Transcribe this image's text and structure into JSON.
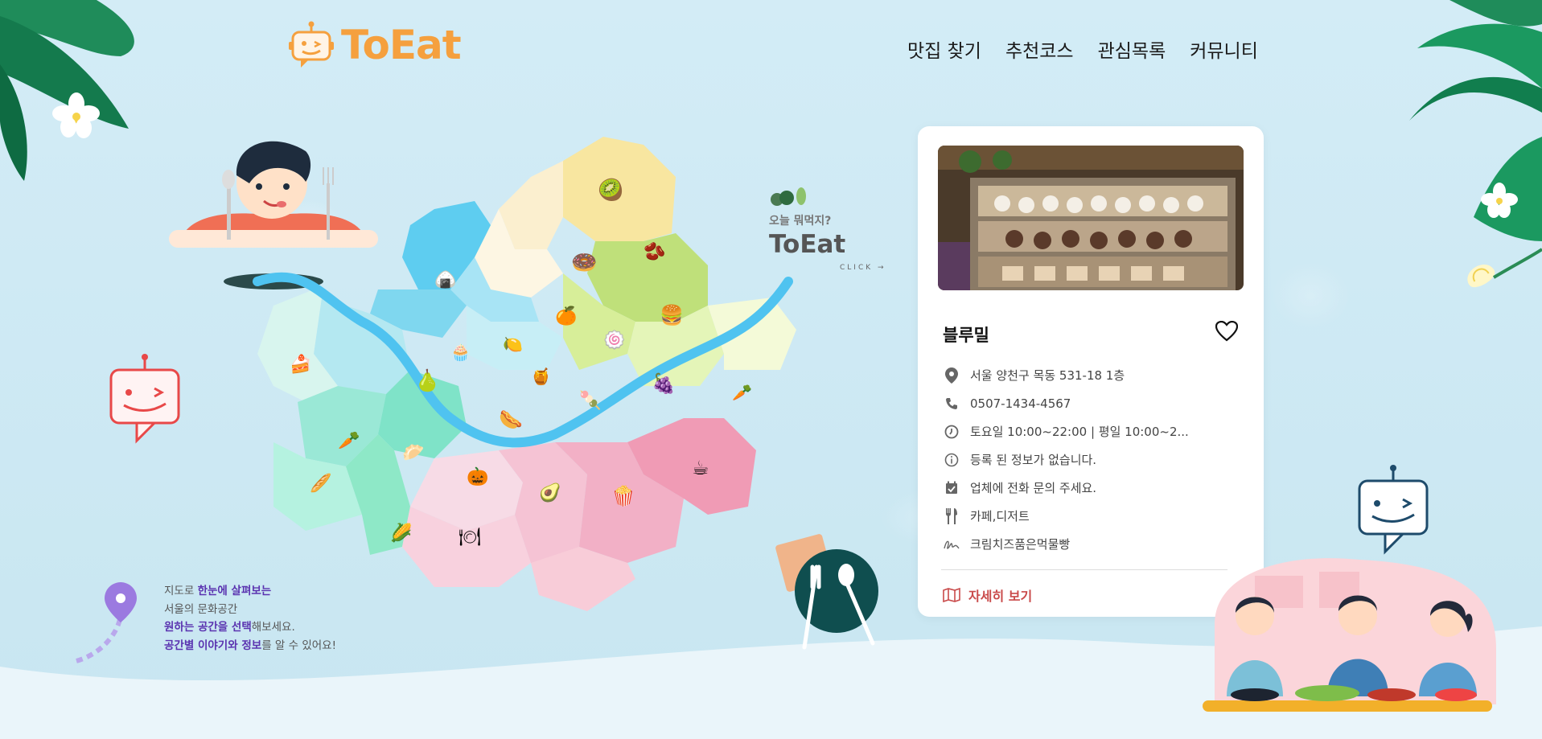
{
  "logo": {
    "text": "ToEat"
  },
  "nav": {
    "items": [
      "맛집 찾기",
      "추천코스",
      "관심목록",
      "커뮤니티"
    ]
  },
  "promo": {
    "question": "오늘 뭐먹지?",
    "brand": "ToEat",
    "click": "CLICK →"
  },
  "caption": {
    "line1_pre": "지도로 ",
    "line1_bold": "한눈에 살펴보는",
    "line2": "서울의 문화공간",
    "line3_bold": "원하는 공간을 선택",
    "line3_post": "해보세요.",
    "line4_bold": "공간별 이야기와 정보",
    "line4_post": "를 알 수 있어요!"
  },
  "place": {
    "name": "블루밀",
    "address": "서울 양천구 목동 531-18 1층",
    "phone": "0507-1434-4567",
    "hours": "토요일 10:00~22:00 | 평일 10:00~2...",
    "info": "등록 된 정보가 없습니다.",
    "reservation": "업체에 전화 문의 주세요.",
    "category": "카페,디저트",
    "menu": "크림치즈품은먹물빵",
    "detail_label": "자세히 보기",
    "icons": [
      "location-pin-icon",
      "phone-icon",
      "clock-icon",
      "info-icon",
      "calendar-check-icon",
      "fork-knife-icon",
      "signature-icon"
    ]
  },
  "colors": {
    "brand": "#f5a03e",
    "accent": "#c94a4a",
    "caption_bold": "#5a33b0",
    "river": "#4fc3f0"
  }
}
